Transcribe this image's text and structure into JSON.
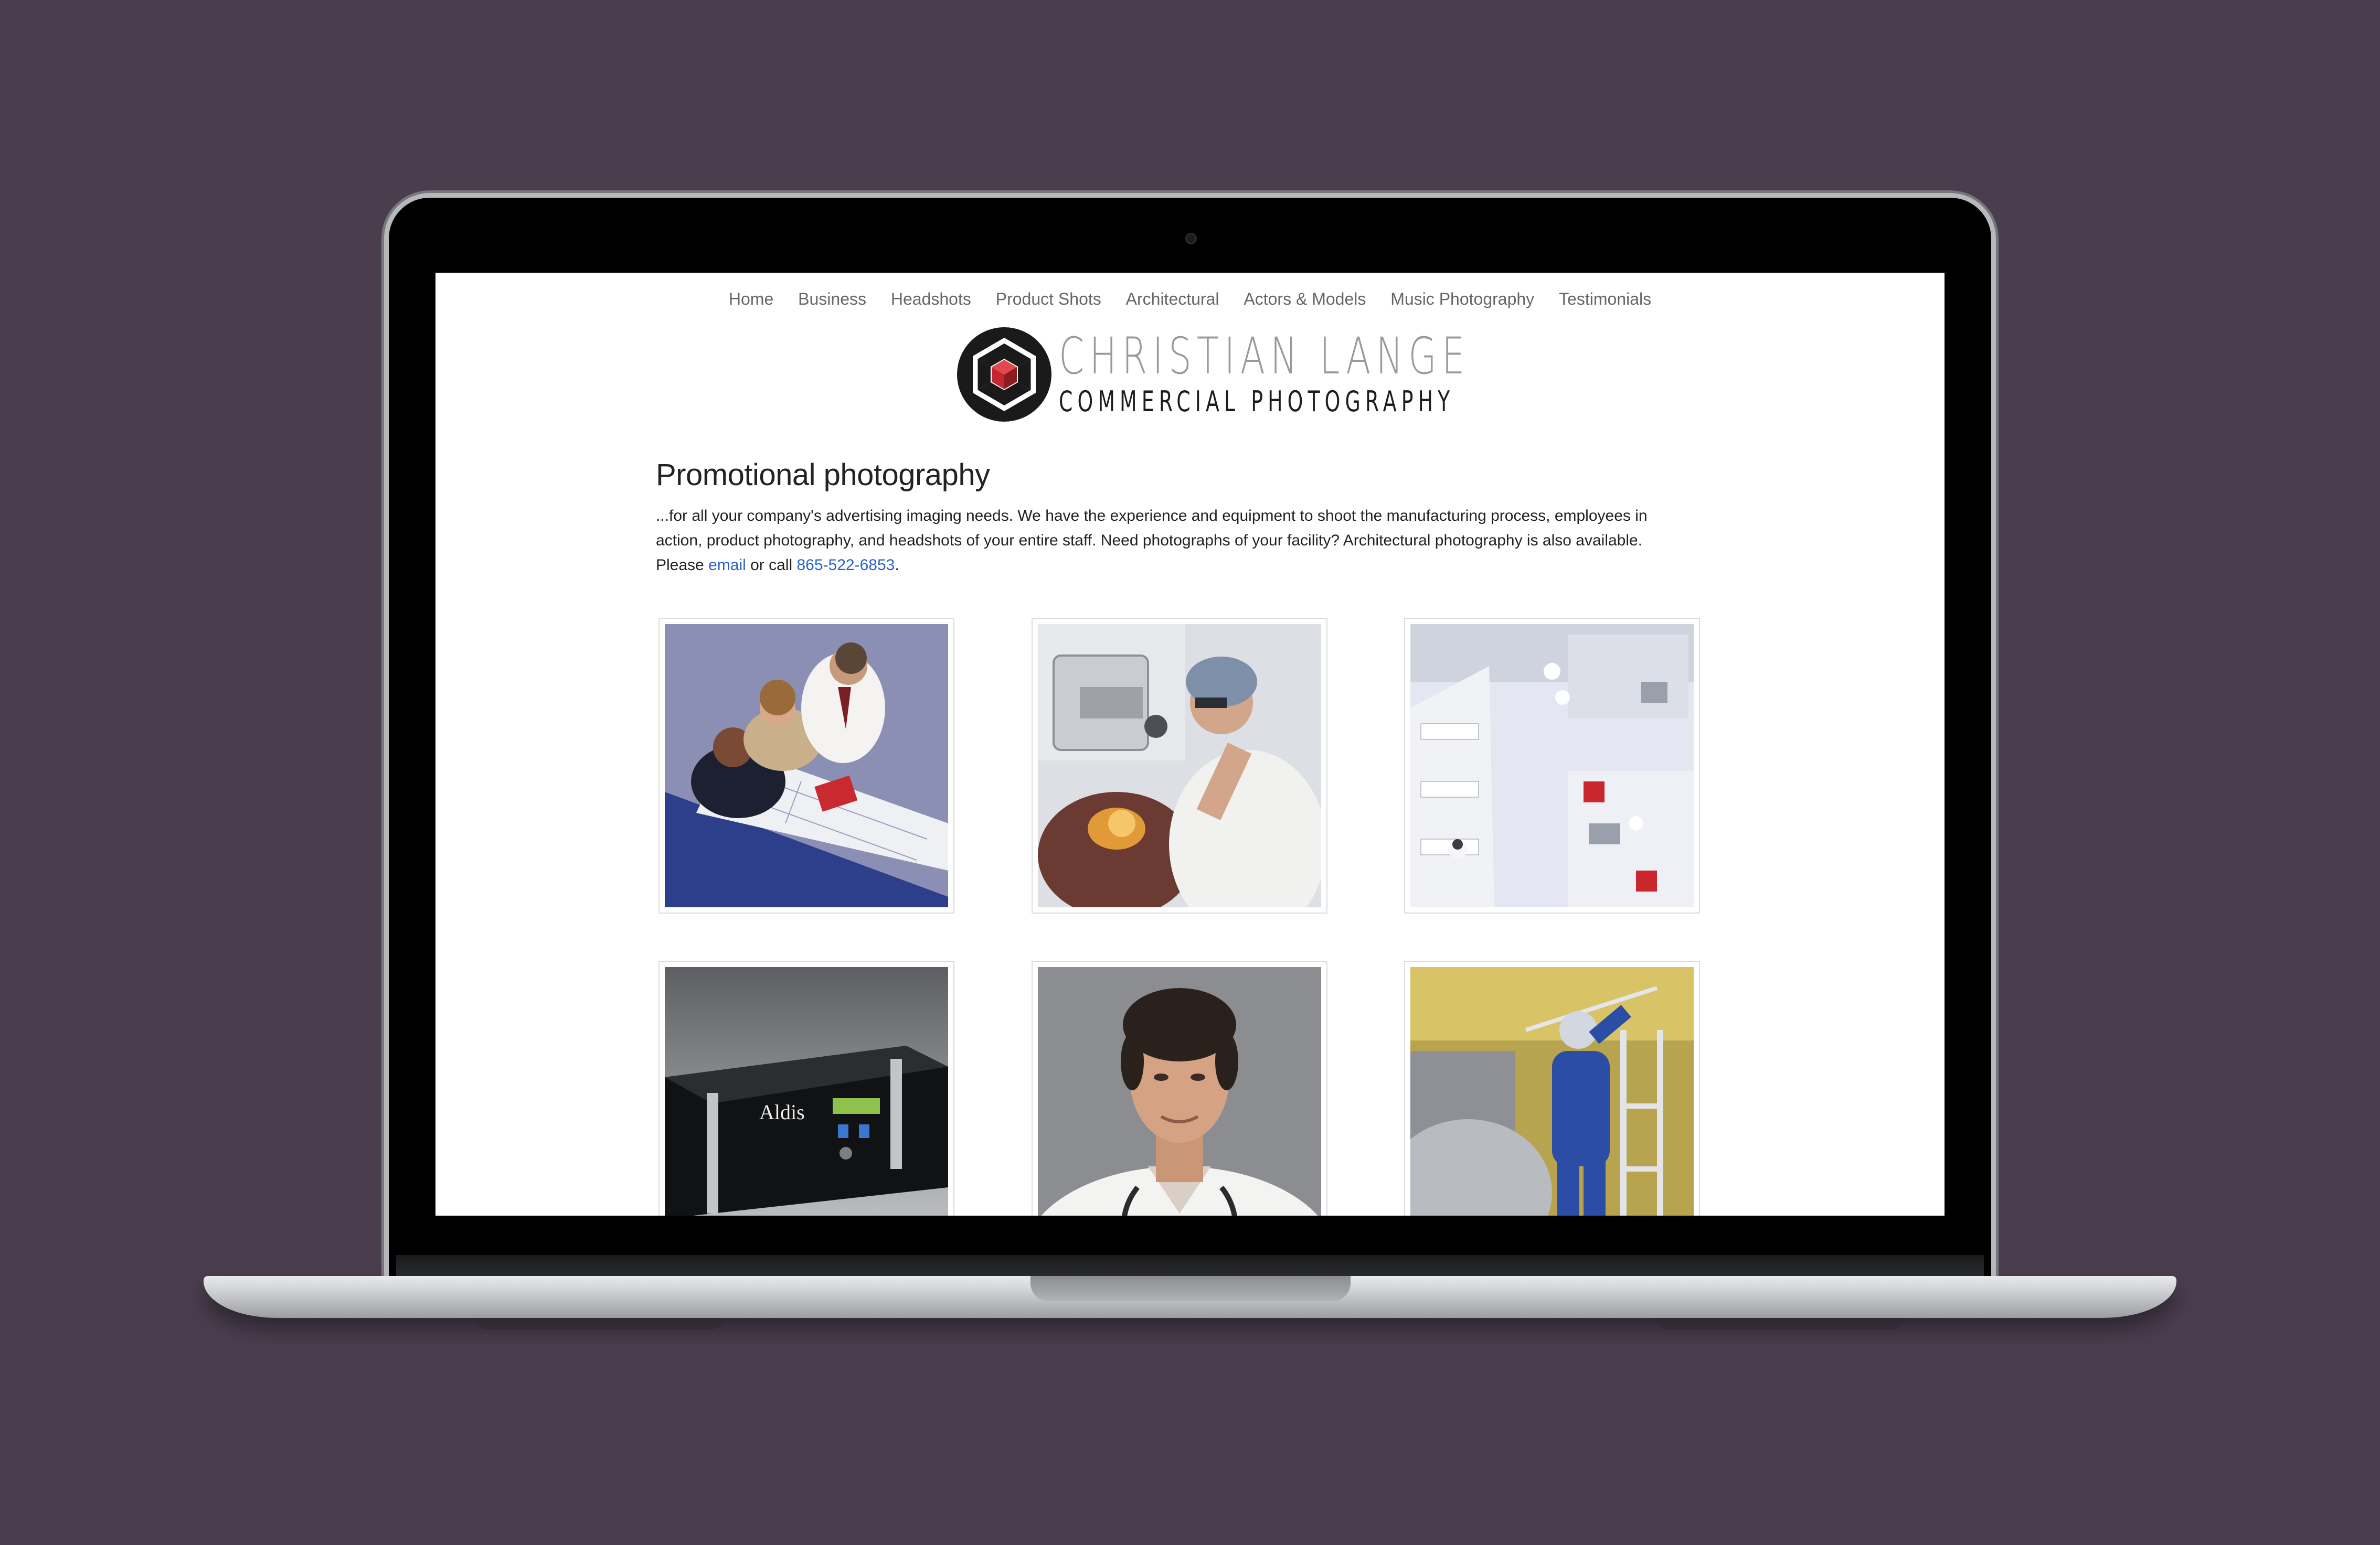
{
  "nav": {
    "items": [
      "Home",
      "Business",
      "Headshots",
      "Product Shots",
      "Architectural",
      "Actors & Models",
      "Music Photography",
      "Testimonials"
    ]
  },
  "logo": {
    "line1": "CHRISTIAN LANGE",
    "line2": "COMMERCIAL PHOTOGRAPHY"
  },
  "content": {
    "heading": "Promotional photography",
    "intro": "...for all your company's advertising imaging needs. We have the experience and equipment to shoot the manufacturing process, employees in action, product photography, and headshots of your entire staff. Need photographs of your facility? Architectural photography is also available. Please ",
    "email_link": "email",
    "or_call": " or call ",
    "phone_link": "865-522-6853",
    "period": ".",
    "aldis_label": "Aldis"
  },
  "colors": {
    "background": "#4a3d4e",
    "link": "#2a64c8",
    "nav_text": "#666666",
    "logo_red": "#c1272d"
  }
}
